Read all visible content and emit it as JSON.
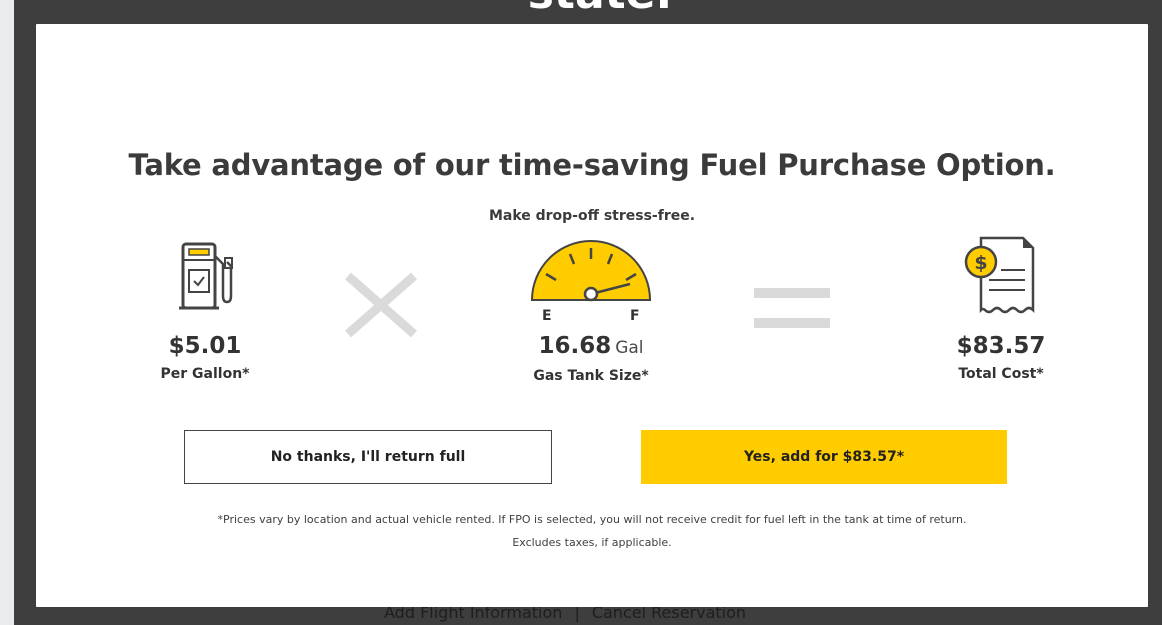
{
  "backdrop": {
    "heading_fragment": "state.",
    "links": [
      {
        "label": "Add Flight Information"
      },
      {
        "label": "Cancel Reservation"
      }
    ],
    "separator": "|"
  },
  "modal": {
    "title": "Take advantage of our time-saving Fuel Purchase Option.",
    "subtitle": "Make drop-off stress-free.",
    "price": {
      "icon": "gas-pump-icon",
      "value": "$5.01",
      "caption": "Per Gallon*"
    },
    "operator_times": "multiply-icon",
    "tank": {
      "icon": "fuel-gauge-icon",
      "gauge_empty_label": "E",
      "gauge_full_label": "F",
      "value": "16.68",
      "unit": "Gal",
      "caption": "Gas Tank Size*"
    },
    "operator_equals": "equals-icon",
    "total": {
      "icon": "receipt-dollar-icon",
      "value": "$83.57",
      "caption": "Total Cost*"
    },
    "buttons": {
      "decline_label": "No thanks, I'll return full",
      "accept_label": "Yes, add for $83.57*"
    },
    "disclaimer_line1": "*Prices vary by location and actual vehicle rented. If FPO is selected, you will not receive credit for fuel left in the tank at time of return.",
    "disclaimer_line2": "Excludes taxes, if applicable."
  },
  "colors": {
    "accent": "#ffcc00",
    "text": "#333333",
    "operator": "#dadada",
    "backdrop": "#3e3e3e"
  }
}
